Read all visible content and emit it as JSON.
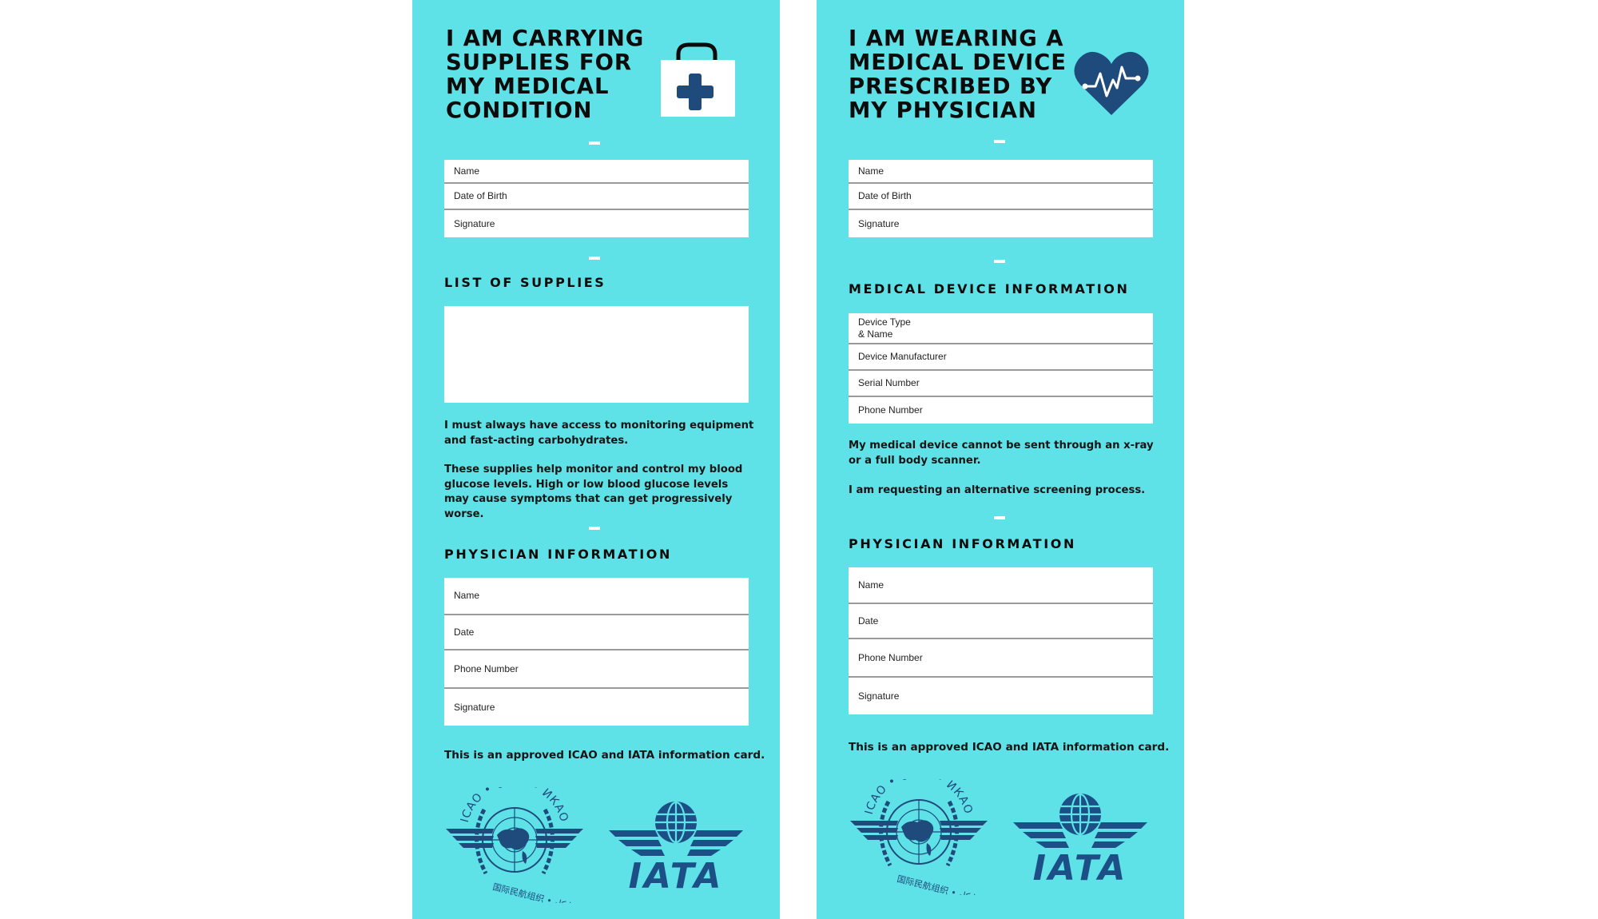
{
  "cards": {
    "supplies": {
      "title_lines": [
        "I AM CARRYING",
        "SUPPLIES FOR",
        "MY MEDICAL",
        "CONDITION"
      ],
      "icon": "medical-kit-icon",
      "personal_fields": [
        "Name",
        "Date of Birth",
        "Signature"
      ],
      "supplies_heading": "LIST OF SUPPLIES",
      "supplies_value": "",
      "paragraph_1": "I must always have access to monitoring equipment and fast-acting carbohydrates.",
      "paragraph_2": "These supplies help monitor and control my blood glucose levels. High or low blood glucose levels may cause symptoms that can get progressively worse.",
      "physician_heading": "PHYSICIAN INFORMATION",
      "physician_fields": [
        "Name",
        "Date",
        "Phone Number",
        "Signature"
      ],
      "approval_text": "This is an approved ICAO and IATA information card.",
      "logos": {
        "icao": {
          "top_text": "ICAO • OACI • ИКАО",
          "bottom_text": "国际民航组织 • ايكاو"
        },
        "iata": {
          "text": "IATA"
        }
      }
    },
    "device": {
      "title_lines": [
        "I AM WEARING A",
        "MEDICAL DEVICE",
        "PRESCRIBED BY",
        "MY PHYSICIAN"
      ],
      "icon": "heartbeat-heart-icon",
      "personal_fields": [
        "Name",
        "Date of Birth",
        "Signature"
      ],
      "device_heading": "MEDICAL DEVICE INFORMATION",
      "device_fields": [
        "Device Type\n& Name",
        "Device Manufacturer",
        "Serial Number",
        "Phone Number"
      ],
      "paragraph_1": "My medical device cannot be sent through an x-ray or a full body scanner.",
      "paragraph_2": "I am requesting an alternative screening process.",
      "physician_heading": "PHYSICIAN INFORMATION",
      "physician_fields": [
        "Name",
        "Date",
        "Phone Number",
        "Signature"
      ],
      "approval_text": "This is an approved ICAO and IATA information card.",
      "logos": {
        "icao": {
          "top_text": "ICAO • OACI • ИКАО",
          "bottom_text": "国际民航组织 • ايكاو"
        },
        "iata": {
          "text": "IATA"
        }
      }
    }
  },
  "colors": {
    "card_background": "#5ee2e7",
    "icon_navy": "#1f4a7c",
    "logo_blue": "#1b4f86",
    "text": "#111111",
    "field_background": "#ffffff",
    "divider": "#9a9a9a"
  }
}
